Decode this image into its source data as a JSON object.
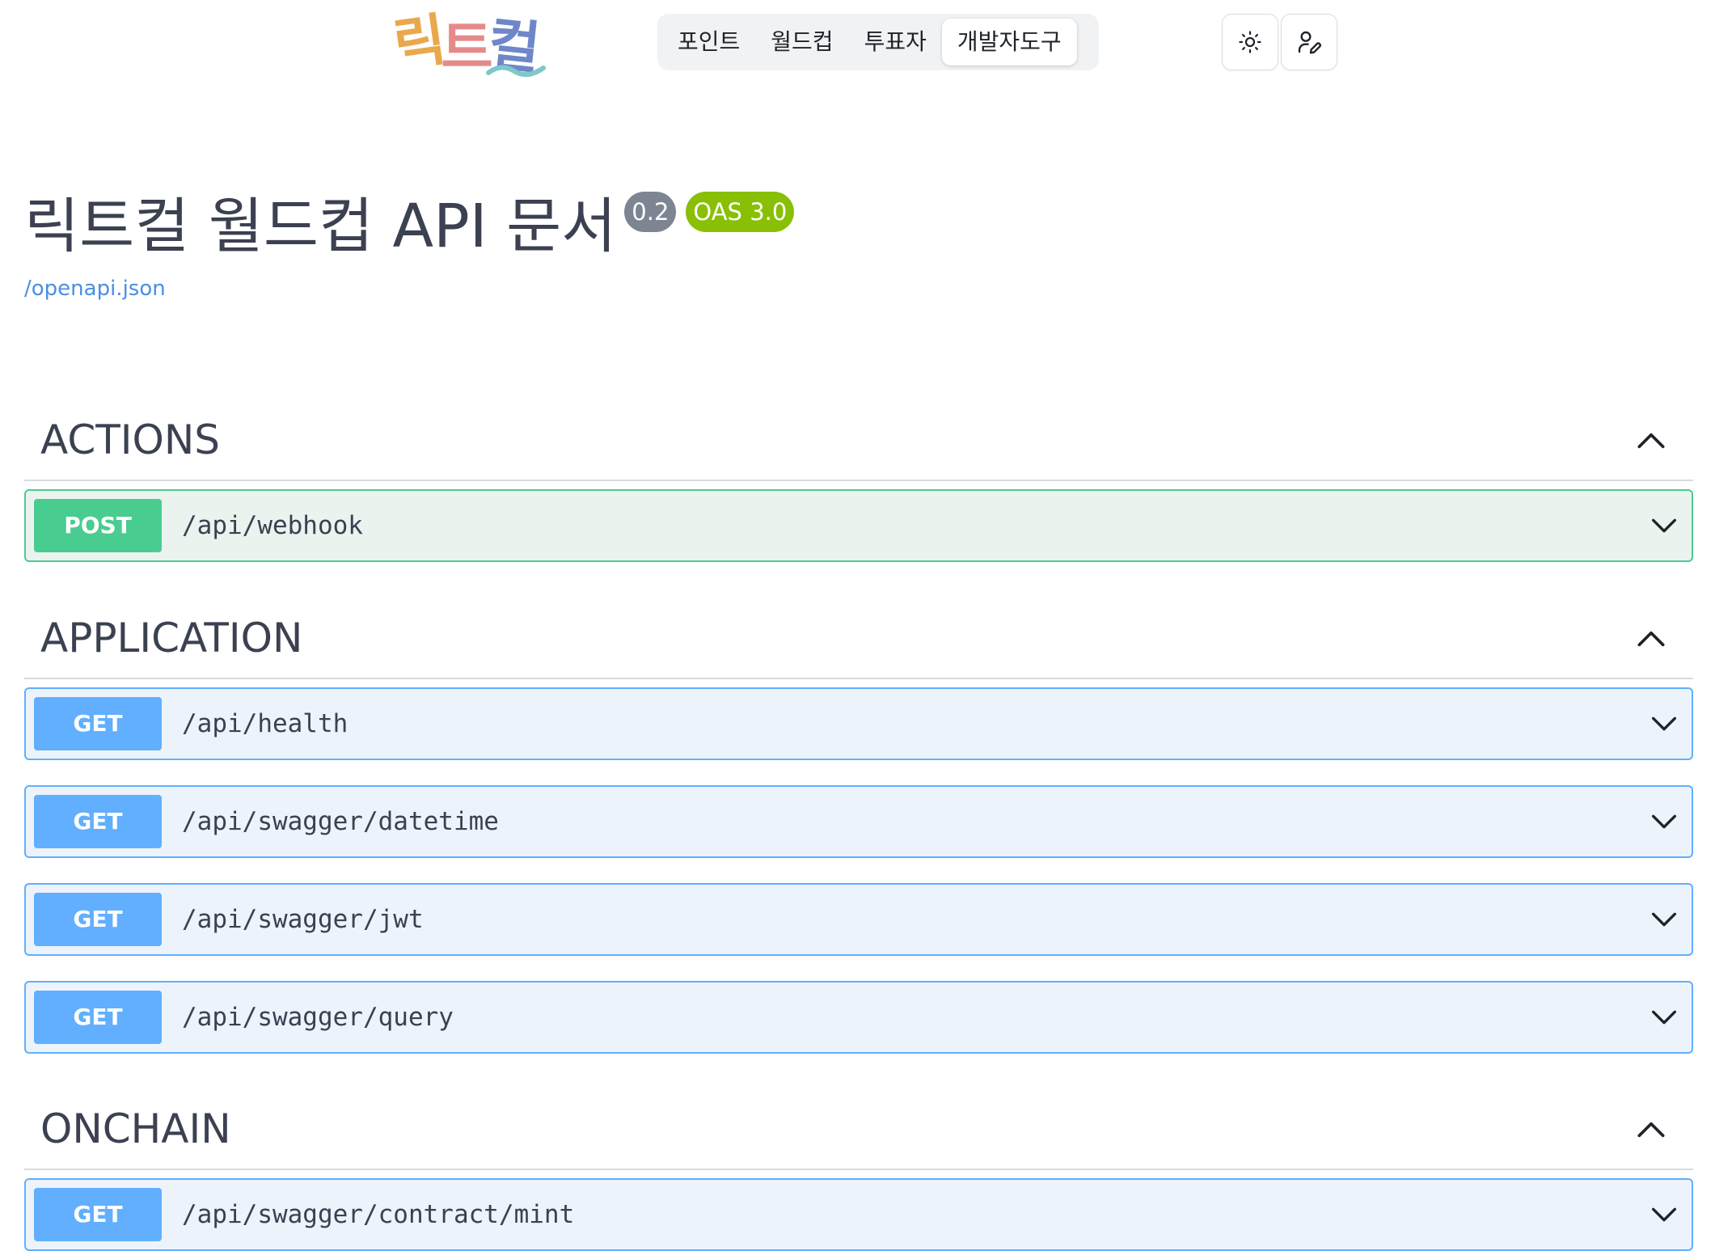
{
  "navbar": {
    "logo_text": [
      "릭",
      "트",
      "컬"
    ],
    "tabs": [
      {
        "label": "포인트",
        "active": false
      },
      {
        "label": "월드컵",
        "active": false
      },
      {
        "label": "투표자",
        "active": false
      },
      {
        "label": "개발자도구",
        "active": true
      }
    ],
    "theme_icon": "sun-icon",
    "account_icon": "user-pen-icon"
  },
  "header": {
    "title": "릭트컬 월드컵 API 문서",
    "version": "0.2",
    "oas": "OAS 3.0",
    "spec_link": "/openapi.json"
  },
  "sections": [
    {
      "title": "ACTIONS",
      "operations": [
        {
          "method": "POST",
          "path": "/api/webhook"
        }
      ]
    },
    {
      "title": "APPLICATION",
      "operations": [
        {
          "method": "GET",
          "path": "/api/health"
        },
        {
          "method": "GET",
          "path": "/api/swagger/datetime"
        },
        {
          "method": "GET",
          "path": "/api/swagger/jwt"
        },
        {
          "method": "GET",
          "path": "/api/swagger/query"
        }
      ]
    },
    {
      "title": "ONCHAIN",
      "operations": [
        {
          "method": "GET",
          "path": "/api/swagger/contract/mint"
        }
      ]
    }
  ],
  "colors": {
    "post": "#49cc90",
    "get": "#61affe",
    "badge_version": "#7d8492",
    "badge_oas": "#89bf04",
    "link": "#4990e2"
  }
}
